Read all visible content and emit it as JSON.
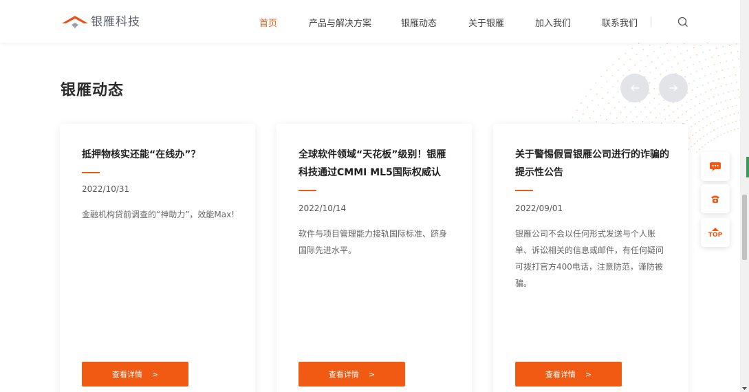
{
  "header": {
    "logo_text": "银雁科技",
    "nav": [
      {
        "label": "首页",
        "active": true
      },
      {
        "label": "产品与解决方案",
        "active": false
      },
      {
        "label": "银雁动态",
        "active": false
      },
      {
        "label": "关于银雁",
        "active": false
      },
      {
        "label": "加入我们",
        "active": false
      },
      {
        "label": "联系我们",
        "active": false
      }
    ],
    "search_icon": "search-icon"
  },
  "section": {
    "title": "银雁动态",
    "prev_icon": "arrow-left-icon",
    "next_icon": "arrow-right-icon"
  },
  "cards": [
    {
      "title": "抵押物核实还能“在线办”？",
      "date": "2022/10/31",
      "desc": "金融机构贷前调查的“神助力”，效能Max!",
      "button": "查看详情"
    },
    {
      "title": "全球软件领域“天花板”级别！银雁科技通过CMMI ML5国际权威认",
      "date": "2022/10/14",
      "desc": "软件与项目管理能力接轨国际标准、跻身国际先进水平。",
      "button": "查看详情"
    },
    {
      "title": "关于警惕假冒银雁公司进行的诈骗的提示性公告",
      "date": "2022/09/01",
      "desc": "银雁公司不会以任何形式发送与个人账单、诉讼相关的信息或邮件，有任何疑问可拨打官方400电话，注意防范，谨防被骗。",
      "button": "查看详情"
    }
  ],
  "side_widgets": {
    "chat_icon": "chat-icon",
    "phone_icon": "phone-icon",
    "top_label": "TOP"
  },
  "colors": {
    "accent": "#f05a12",
    "arrow_bg": "#e2e4e8"
  }
}
